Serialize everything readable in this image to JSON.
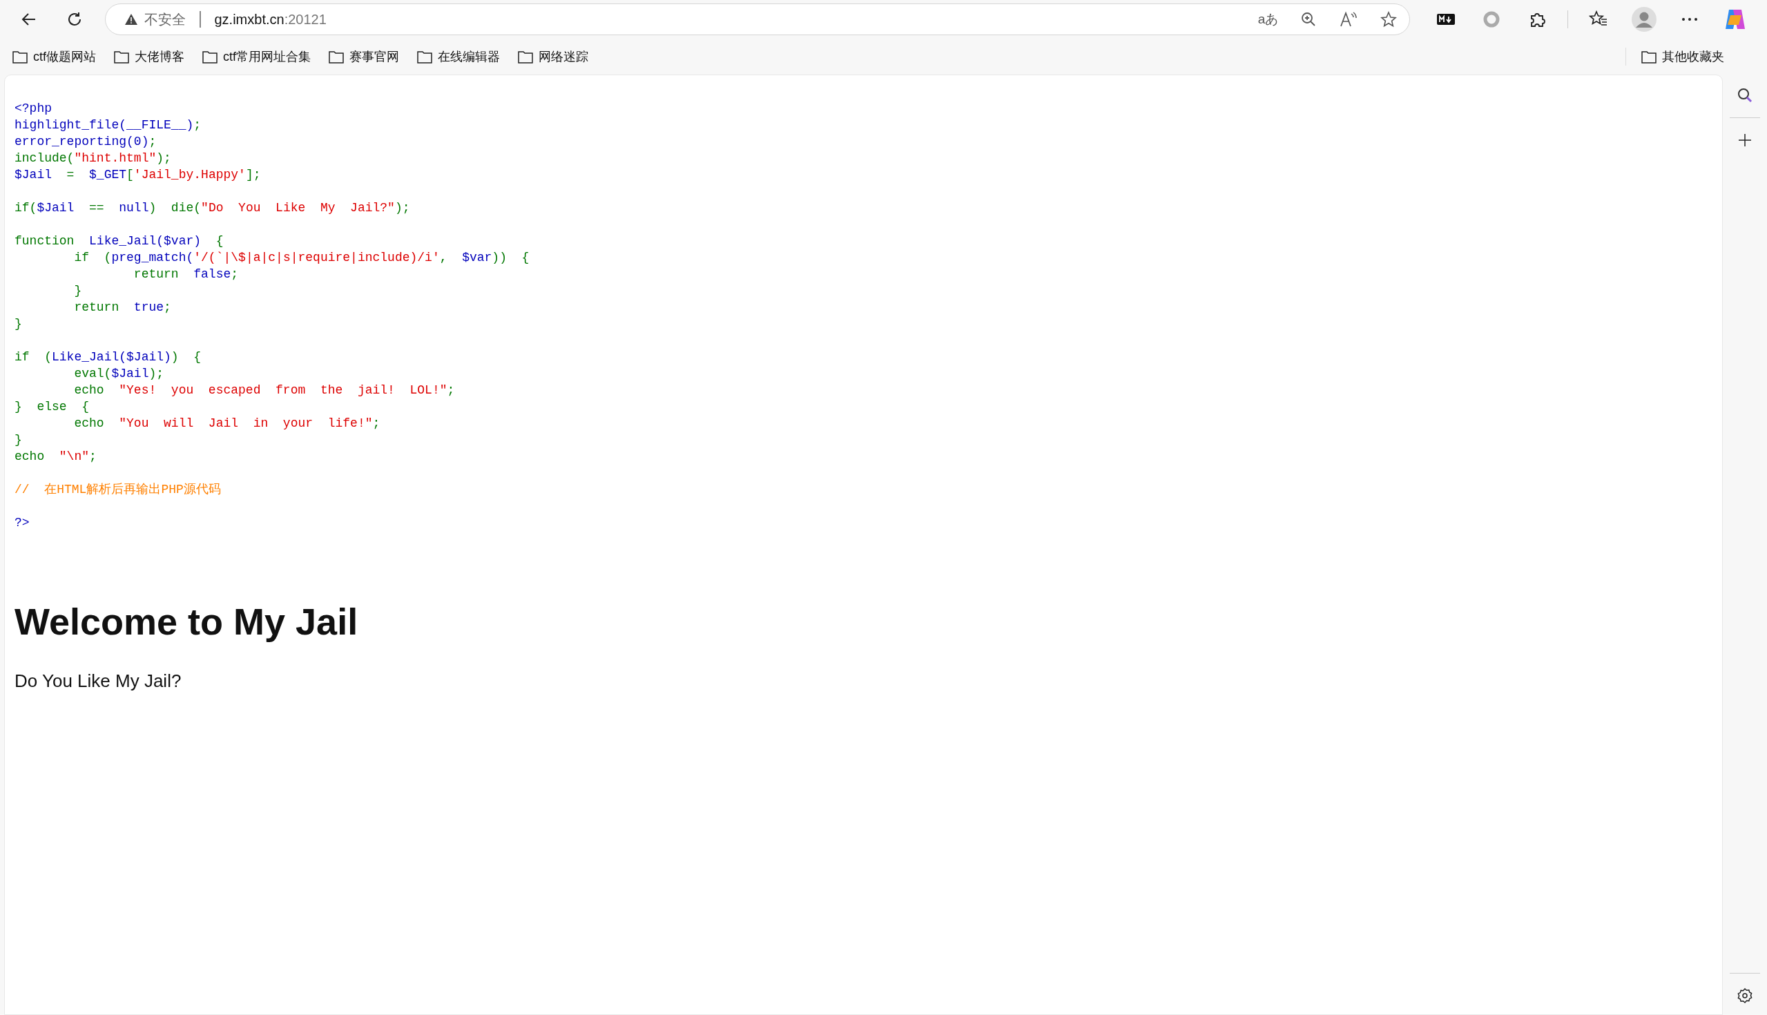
{
  "toolbar": {
    "address": {
      "security_label": "不安全",
      "host": "gz.imxbt.cn",
      "port": ":20121"
    },
    "translate_label": "aあ"
  },
  "bookmarks": [
    "ctf做题网站",
    "大佬博客",
    "ctf常用网址合集",
    "赛事官网",
    "在线编辑器",
    "网络迷踪"
  ],
  "other_bookmarks": "其他收藏夹",
  "page": {
    "code_blocks": [
      [
        [
          {
            "kind": "default",
            "text": "<?php"
          }
        ],
        [
          {
            "kind": "default",
            "text": "highlight_file(__FILE__)"
          },
          {
            "kind": "keyword",
            "text": ";"
          }
        ],
        [
          {
            "kind": "default",
            "text": "error_reporting(0)"
          },
          {
            "kind": "keyword",
            "text": ";"
          }
        ],
        [
          {
            "kind": "keyword",
            "text": "include("
          },
          {
            "kind": "string",
            "text": "\"hint.html\""
          },
          {
            "kind": "keyword",
            "text": ");"
          }
        ],
        [
          {
            "kind": "default",
            "text": "$Jail"
          },
          {
            "kind": "keyword",
            "text": "  =  "
          },
          {
            "kind": "default",
            "text": "$_GET"
          },
          {
            "kind": "keyword",
            "text": "["
          },
          {
            "kind": "string",
            "text": "'Jail_by.Happy'"
          },
          {
            "kind": "keyword",
            "text": "];"
          }
        ]
      ],
      [
        [
          {
            "kind": "keyword",
            "text": "if("
          },
          {
            "kind": "default",
            "text": "$Jail"
          },
          {
            "kind": "keyword",
            "text": "  ==  "
          },
          {
            "kind": "default",
            "text": "null"
          },
          {
            "kind": "keyword",
            "text": ")  die("
          },
          {
            "kind": "string",
            "text": "\"Do  You  Like  My  Jail?\""
          },
          {
            "kind": "keyword",
            "text": ");"
          }
        ]
      ],
      [
        [
          {
            "kind": "keyword",
            "text": "function  "
          },
          {
            "kind": "default",
            "text": "Like_Jail($var)"
          },
          {
            "kind": "keyword",
            "text": "  {"
          }
        ],
        [
          {
            "kind": "keyword",
            "text": "        if  ("
          },
          {
            "kind": "default",
            "text": "preg_match("
          },
          {
            "kind": "string",
            "text": "'/(`|\\$|a|c|s|require|include)/i'"
          },
          {
            "kind": "keyword",
            "text": ",  "
          },
          {
            "kind": "default",
            "text": "$var"
          },
          {
            "kind": "keyword",
            "text": "))  {"
          }
        ],
        [
          {
            "kind": "keyword",
            "text": "                return  "
          },
          {
            "kind": "default",
            "text": "false"
          },
          {
            "kind": "keyword",
            "text": ";"
          }
        ],
        [
          {
            "kind": "keyword",
            "text": "        }"
          }
        ],
        [
          {
            "kind": "keyword",
            "text": "        return  "
          },
          {
            "kind": "default",
            "text": "true"
          },
          {
            "kind": "keyword",
            "text": ";"
          }
        ],
        [
          {
            "kind": "keyword",
            "text": "}"
          }
        ]
      ],
      [
        [
          {
            "kind": "keyword",
            "text": "if  ("
          },
          {
            "kind": "default",
            "text": "Like_Jail($Jail)"
          },
          {
            "kind": "keyword",
            "text": ")  {"
          }
        ],
        [
          {
            "kind": "keyword",
            "text": "        eval("
          },
          {
            "kind": "default",
            "text": "$Jail"
          },
          {
            "kind": "keyword",
            "text": ");"
          }
        ],
        [
          {
            "kind": "keyword",
            "text": "        echo  "
          },
          {
            "kind": "string",
            "text": "\"Yes!  you  escaped  from  the  jail!  LOL!\""
          },
          {
            "kind": "keyword",
            "text": ";"
          }
        ],
        [
          {
            "kind": "keyword",
            "text": "}  else  {"
          }
        ],
        [
          {
            "kind": "keyword",
            "text": "        echo  "
          },
          {
            "kind": "string",
            "text": "\"You  will  Jail  in  your  life!\""
          },
          {
            "kind": "keyword",
            "text": ";"
          }
        ],
        [
          {
            "kind": "keyword",
            "text": "}"
          }
        ],
        [
          {
            "kind": "keyword",
            "text": "echo  "
          },
          {
            "kind": "string",
            "text": "\"\\n\""
          },
          {
            "kind": "keyword",
            "text": ";"
          }
        ]
      ],
      [
        [
          {
            "kind": "comment",
            "text": "//  在HTML解析后再输出PHP源代码"
          }
        ]
      ],
      [
        [
          {
            "kind": "default",
            "text": "?>"
          }
        ]
      ]
    ],
    "heading": "Welcome to My Jail",
    "message": "Do You Like My Jail?"
  }
}
